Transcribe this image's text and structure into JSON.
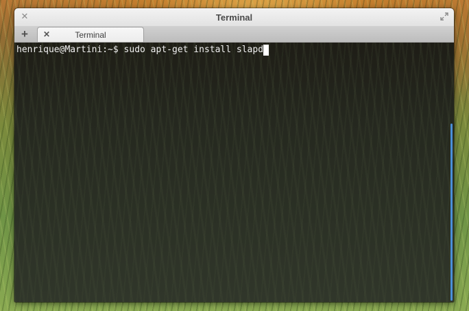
{
  "window": {
    "title": "Terminal",
    "close_icon": "close-icon",
    "maximize_icon": "maximize-icon"
  },
  "tabbar": {
    "new_tab_label": "+",
    "tabs": [
      {
        "label": "Terminal",
        "close_label": "✕",
        "active": true
      }
    ]
  },
  "terminal": {
    "prompt": "henrique@Martini:~$",
    "command": "sudo apt-get install slapd"
  },
  "colors": {
    "scrollbar_accent": "#4a8fd8",
    "terminal_text": "#f0f0f0"
  }
}
